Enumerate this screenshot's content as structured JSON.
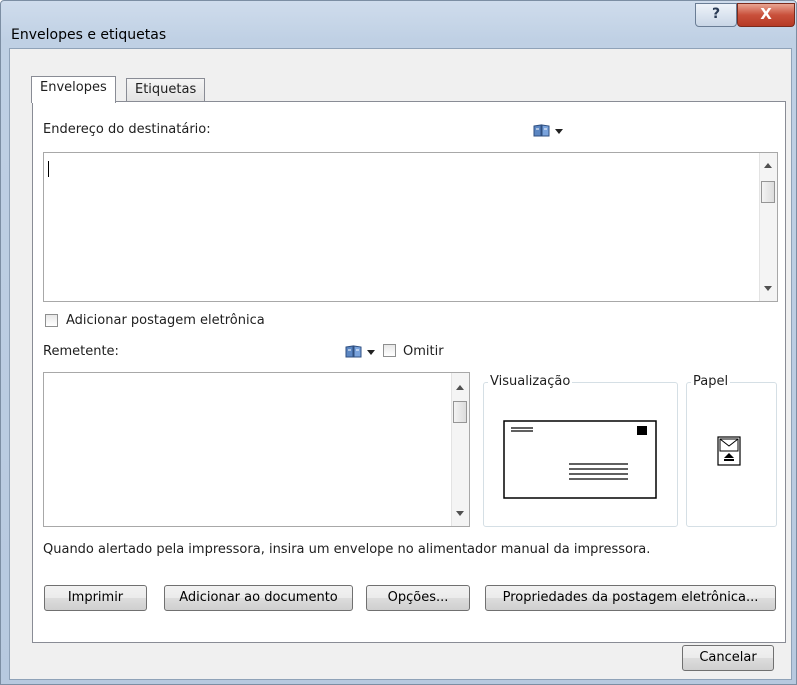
{
  "window": {
    "title": "Envelopes e etiquetas",
    "help_glyph": "?",
    "close_glyph": "X"
  },
  "tabs": [
    {
      "label": "Envelopes",
      "active": true
    },
    {
      "label": "Etiquetas",
      "active": false
    }
  ],
  "recipient": {
    "label": "Endereço do destinatário:",
    "address_book_icon": "address-book-icon",
    "value": ""
  },
  "electronic_postage": {
    "label": "Adicionar postagem eletrônica",
    "checked": false
  },
  "sender": {
    "label": "Remetente:",
    "address_book_icon": "address-book-icon",
    "omit_label": "Omitir",
    "omit_checked": false,
    "value": ""
  },
  "preview": {
    "label": "Visualização",
    "icon": "envelope-preview-icon"
  },
  "paper": {
    "label": "Papel",
    "icon": "envelope-feed-icon"
  },
  "note": "Quando alertado pela impressora, insira um envelope no alimentador manual da impressora.",
  "buttons": {
    "print": "Imprimir",
    "add_to_document": "Adicionar ao documento",
    "options": "Opções...",
    "postage_properties": "Propriedades da postagem eletrônica...",
    "cancel": "Cancelar"
  }
}
